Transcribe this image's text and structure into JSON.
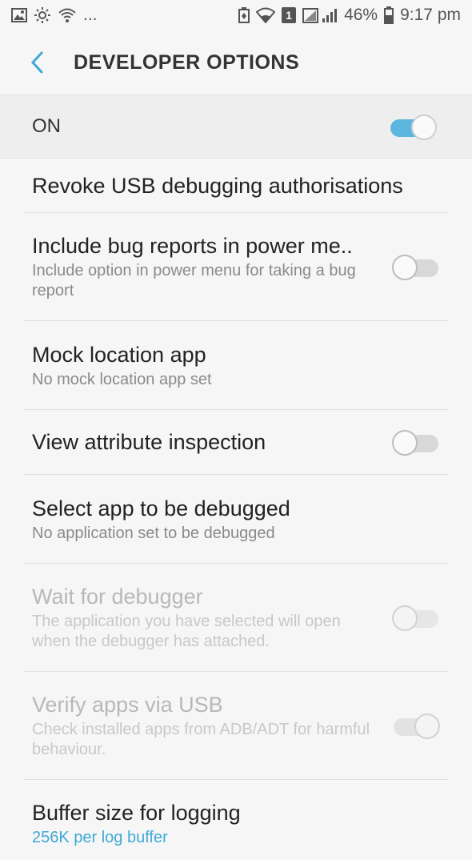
{
  "status_bar": {
    "notification_icons": [
      "image-icon",
      "brightness-icon",
      "wifi-call-icon"
    ],
    "overflow": "...",
    "battery_percent": "46%",
    "time": "9:17 pm",
    "sim_badge": "1"
  },
  "header": {
    "title": "DEVELOPER OPTIONS",
    "back_icon": "chevron-left-icon",
    "accent_color": "#3fa9d6"
  },
  "master_switch": {
    "label": "ON",
    "on": true
  },
  "settings": [
    {
      "title": "Revoke USB debugging authorisations"
    },
    {
      "title": "Include bug reports in power me..",
      "subtitle": "Include option in power menu for taking a bug report",
      "toggle": false
    },
    {
      "title": "Mock location app",
      "subtitle": "No mock location app set"
    },
    {
      "title": "View attribute inspection",
      "toggle": false
    },
    {
      "title": "Select app to be debugged",
      "subtitle": "No application set to be debugged"
    },
    {
      "title": "Wait for debugger",
      "subtitle": "The application you have selected will open when the debugger has attached.",
      "toggle": false,
      "disabled": true
    },
    {
      "title": "Verify apps via USB",
      "subtitle": "Check installed apps from ADB/ADT for harmful behaviour.",
      "toggle": true,
      "disabled": true
    },
    {
      "title": "Buffer size for logging",
      "subtitle": "256K per log buffer"
    }
  ]
}
